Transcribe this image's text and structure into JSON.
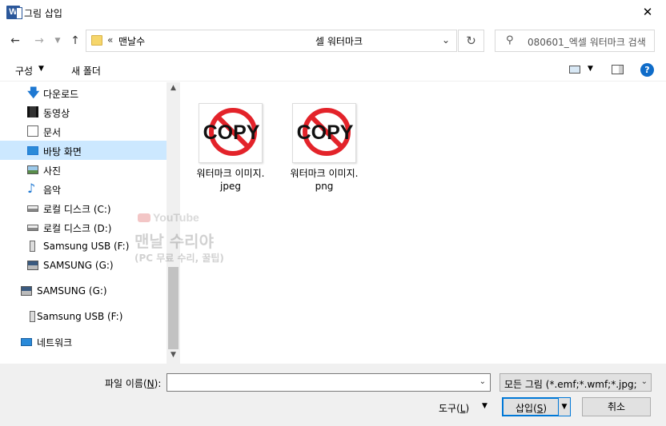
{
  "window": {
    "title": "그림 삽입",
    "app_icon": "W",
    "close_glyph": "✕"
  },
  "navigation": {
    "address_chevrons": "«",
    "address_segments": [
      "맨날수",
      "셀 워터마크"
    ],
    "search_placeholder": "080601_엑셀 워터마크 검색"
  },
  "toolbar": {
    "organize_label": "구성",
    "new_folder_label": "새 폴더"
  },
  "nav_pane": {
    "items": [
      {
        "label": "다운로드",
        "icon": "download-icon",
        "indent": 1
      },
      {
        "label": "동영상",
        "icon": "video-icon",
        "indent": 1
      },
      {
        "label": "문서",
        "icon": "document-icon",
        "indent": 1
      },
      {
        "label": "바탕 화면",
        "icon": "desktop-icon",
        "indent": 1,
        "selected": true
      },
      {
        "label": "사진",
        "icon": "pictures-icon",
        "indent": 1
      },
      {
        "label": "음악",
        "icon": "music-icon",
        "indent": 1
      },
      {
        "label": "로컬 디스크 (C:)",
        "icon": "local-disk-icon",
        "indent": 1
      },
      {
        "label": "로컬 디스크 (D:)",
        "icon": "local-disk-icon",
        "indent": 1
      },
      {
        "label": "Samsung USB (F:)",
        "icon": "usb-drive-icon",
        "indent": 1
      },
      {
        "label": "SAMSUNG (G:)",
        "icon": "samsung-drive-icon",
        "indent": 1
      },
      {
        "label": "SAMSUNG (G:)",
        "icon": "samsung-drive-icon",
        "indent": 0
      },
      {
        "label": "Samsung USB (F:)",
        "icon": "usb-drive-icon",
        "indent": 0
      },
      {
        "label": "네트워크",
        "icon": "network-icon",
        "indent": 0
      }
    ]
  },
  "files": [
    {
      "name": "워터마크 이미지.jpeg",
      "line1": "워터마크 이미지.",
      "line2": "jpeg",
      "thumb_text": "COPY"
    },
    {
      "name": "워터마크 이미지.png",
      "line1": "워터마크 이미지.",
      "line2": "png",
      "thumb_text": "COPY"
    }
  ],
  "watermark": {
    "badge": "YouTube",
    "name": "맨날 수리야",
    "subtitle": "(PC 무료 수리, 꿀팁)"
  },
  "bottom": {
    "filename_label": "파일 이름(",
    "filename_hotkey": "N",
    "filename_label_end": "):",
    "filename_value": "",
    "filetype_value": "모든 그림 (*.emf;*.wmf;*.jpg;*.",
    "tools_label": "도구(",
    "tools_hotkey": "L",
    "tools_label_end": ")",
    "insert_label": "삽입(",
    "insert_hotkey": "S",
    "insert_label_end": ")",
    "cancel_label": "취소"
  },
  "colors": {
    "accent": "#0078d7",
    "selection": "#cce8ff",
    "copy_red": "#e3232a"
  }
}
